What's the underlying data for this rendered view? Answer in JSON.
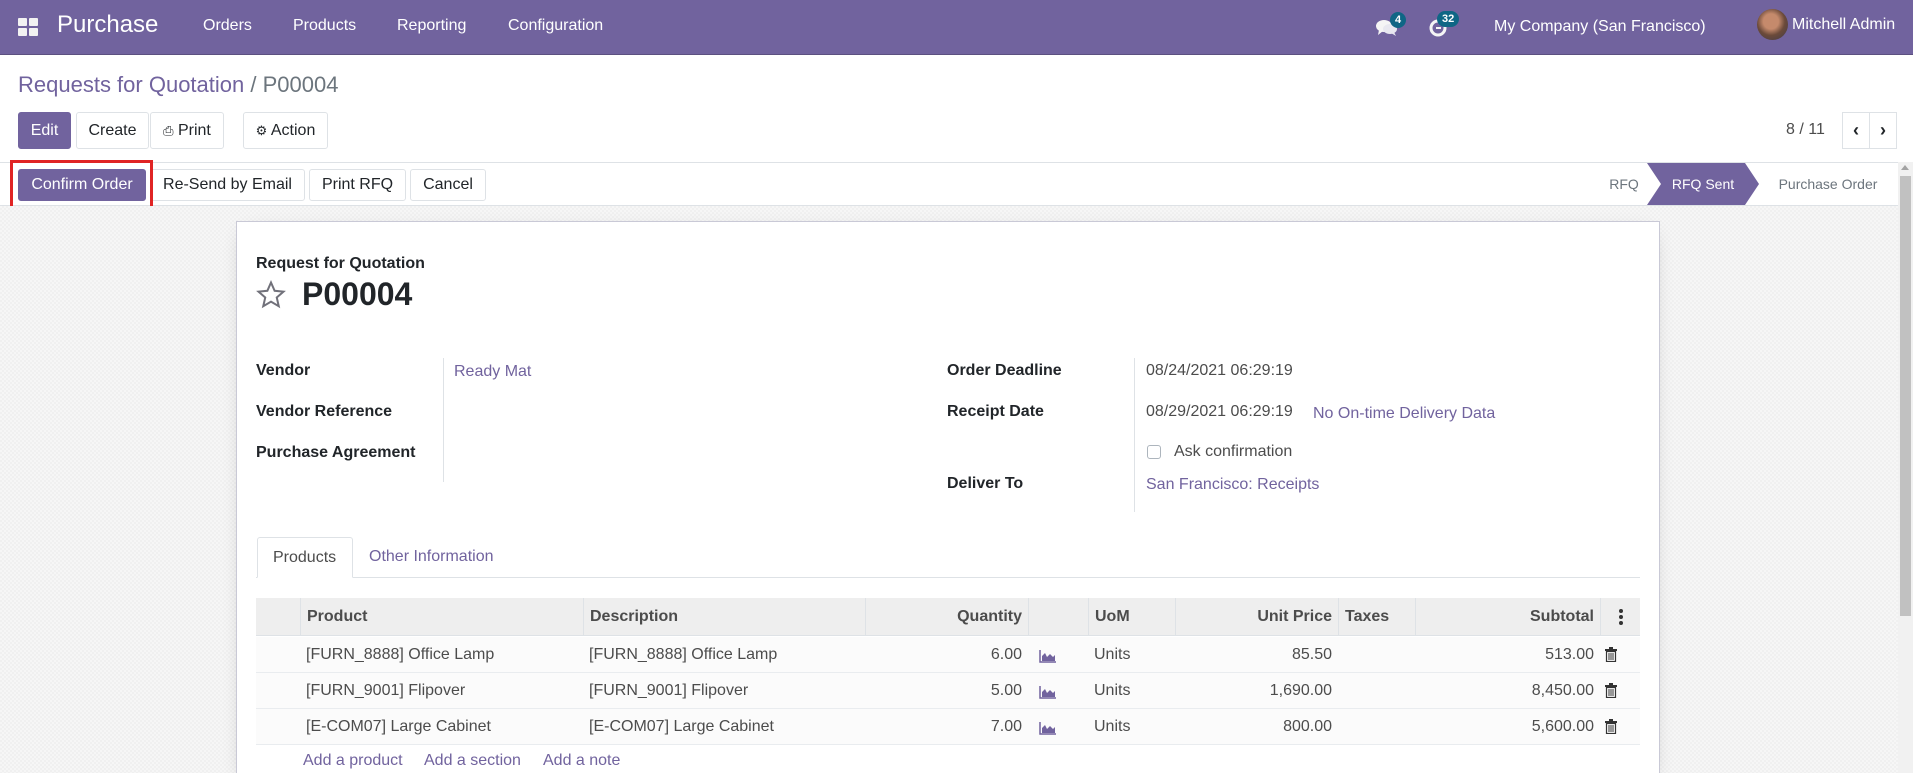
{
  "navbar": {
    "app_name": "Purchase",
    "menu": [
      "Orders",
      "Products",
      "Reporting",
      "Configuration"
    ],
    "messages_count": "4",
    "activities_count": "32",
    "company": "My Company (San Francisco)",
    "user": "Mitchell Admin"
  },
  "breadcrumb": {
    "parent": "Requests for Quotation",
    "separator": "/",
    "current": "P00004"
  },
  "control_buttons": {
    "edit": "Edit",
    "create": "Create",
    "print": "Print",
    "action": "Action"
  },
  "pager": {
    "value": "8 / 11",
    "prev": "‹",
    "next": "›"
  },
  "status_buttons": {
    "confirm_order": "Confirm Order",
    "resend_email": "Re-Send by Email",
    "print_rfq": "Print RFQ",
    "cancel": "Cancel"
  },
  "stages": [
    {
      "label": "RFQ",
      "active": false
    },
    {
      "label": "RFQ Sent",
      "active": true
    },
    {
      "label": "Purchase Order",
      "active": false
    }
  ],
  "form": {
    "subtitle": "Request for Quotation",
    "name": "P00004",
    "left_fields": [
      {
        "label": "Vendor",
        "value": "Ready Mat"
      },
      {
        "label": "Vendor Reference",
        "value": ""
      },
      {
        "label": "Purchase Agreement",
        "value": ""
      }
    ],
    "right_fields": {
      "order_deadline": {
        "label": "Order Deadline",
        "value": "08/24/2021 06:29:19"
      },
      "receipt_date": {
        "label": "Receipt Date",
        "value": "08/29/2021 06:29:19",
        "extra": "No On-time Delivery Data"
      },
      "ask_confirmation": {
        "label": "Ask confirmation",
        "checked": false
      },
      "deliver_to": {
        "label": "Deliver To",
        "value": "San Francisco: Receipts"
      }
    }
  },
  "tabs": [
    {
      "label": "Products",
      "active": true
    },
    {
      "label": "Other Information",
      "active": false
    }
  ],
  "order_lines": {
    "columns": [
      "Product",
      "Description",
      "Quantity",
      "UoM",
      "Unit Price",
      "Taxes",
      "Subtotal"
    ],
    "rows": [
      {
        "product": "[FURN_8888] Office Lamp",
        "description": "[FURN_8888] Office Lamp",
        "quantity": "6.00",
        "uom": "Units",
        "unit_price": "85.50",
        "taxes": "",
        "subtotal": "513.00"
      },
      {
        "product": "[FURN_9001] Flipover",
        "description": "[FURN_9001] Flipover",
        "quantity": "5.00",
        "uom": "Units",
        "unit_price": "1,690.00",
        "taxes": "",
        "subtotal": "8,450.00"
      },
      {
        "product": "[E-COM07] Large Cabinet",
        "description": "[E-COM07] Large Cabinet",
        "quantity": "7.00",
        "uom": "Units",
        "unit_price": "800.00",
        "taxes": "",
        "subtotal": "5,600.00"
      }
    ],
    "add_links": [
      "Add a product",
      "Add a section",
      "Add a note"
    ]
  },
  "colors": {
    "brand": "#71639e",
    "badge": "#0f6685",
    "highlight": "#e02424"
  }
}
